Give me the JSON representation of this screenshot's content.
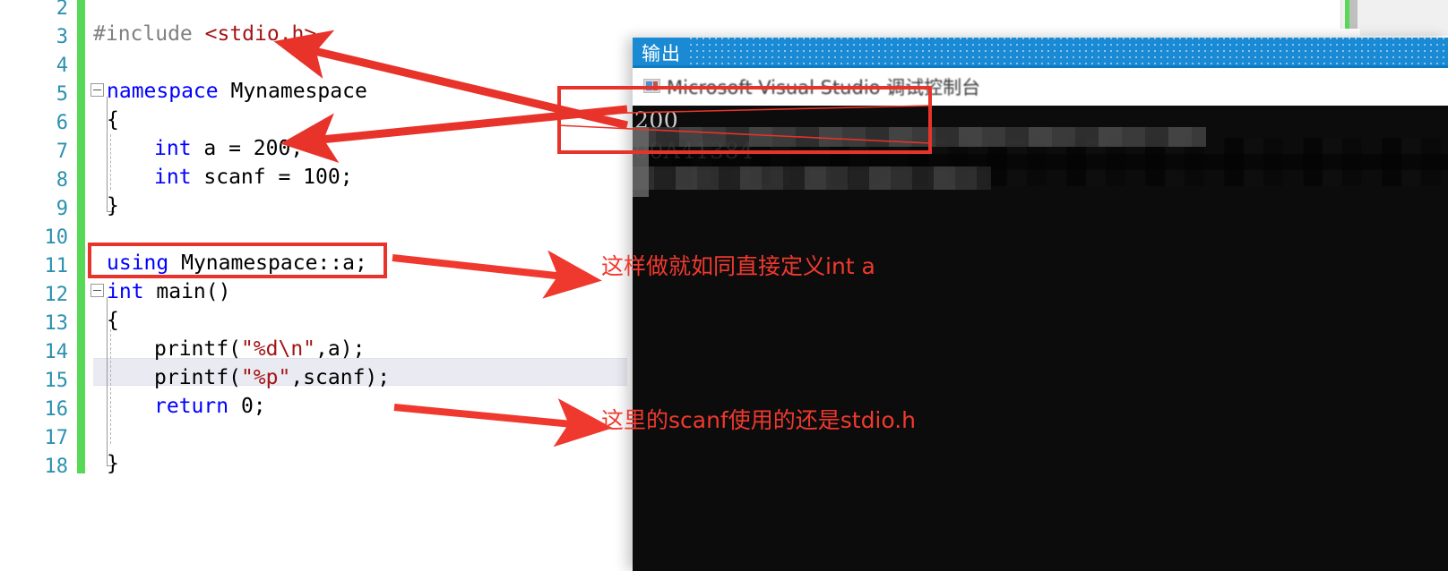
{
  "editor": {
    "name": "visual-studio-code-editor",
    "first_line_number": 2,
    "last_line_number": 18,
    "line_numbers": [
      2,
      3,
      4,
      5,
      6,
      7,
      8,
      9,
      10,
      11,
      12,
      13,
      14,
      15,
      16,
      17,
      18
    ],
    "current_line": 15,
    "colors": {
      "keyword": "#0000ff",
      "preprocessor": "#808080",
      "string": "#a31515",
      "plain": "#000000",
      "line_number": "#2b91af",
      "change_bar": "#57d957",
      "current_line_highlight": "#eaeaf2"
    },
    "lines": [
      {
        "n": 2,
        "text": ""
      },
      {
        "n": 3,
        "text": "#include <stdio.h>"
      },
      {
        "n": 4,
        "text": ""
      },
      {
        "n": 5,
        "text": "namespace Mynamespace"
      },
      {
        "n": 6,
        "text": "{"
      },
      {
        "n": 7,
        "text": "    int a = 200;"
      },
      {
        "n": 8,
        "text": "    int scanf = 100;"
      },
      {
        "n": 9,
        "text": "}"
      },
      {
        "n": 10,
        "text": ""
      },
      {
        "n": 11,
        "text": "using Mynamespace::a;"
      },
      {
        "n": 12,
        "text": "int main()"
      },
      {
        "n": 13,
        "text": "{"
      },
      {
        "n": 14,
        "text": "    printf(\"%d\\n\",a);"
      },
      {
        "n": 15,
        "text": "    printf(\"%p\",scanf);"
      },
      {
        "n": 16,
        "text": "    return 0;"
      },
      {
        "n": 17,
        "text": ""
      },
      {
        "n": 18,
        "text": "}"
      }
    ],
    "tokens": {
      "l3_include": "#include ",
      "l3_header": "<stdio.h>",
      "l5_kw": "namespace",
      "l5_name": " Mynamespace",
      "l6": "{",
      "l7_kw": "int",
      "l7_rest": " a = 200;",
      "l8_kw": "int",
      "l8_rest": " scanf = 100;",
      "l9": "}",
      "l11_kw": "using",
      "l11_rest": " Mynamespace::a;",
      "l12_kw": "int",
      "l12_rest": " main()",
      "l13": "{",
      "l14_a": "printf(",
      "l14_str": "\"%d\\n\"",
      "l14_b": ",a);",
      "l15_a": "printf(",
      "l15_str": "\"%p\"",
      "l15_b": ",scanf);",
      "l16_kw": "return",
      "l16_rest": " 0;",
      "l18": "}"
    }
  },
  "console": {
    "title": "输出",
    "header_text": "Microsoft Visual Studio 调试控制台",
    "output_lines": [
      "200",
      "00A41384"
    ],
    "background": "#0c0c0c",
    "titlebar_color": "#1a8ad4",
    "text_color": "#cccccc"
  },
  "annotations": {
    "color": "#f0392e",
    "notes": [
      {
        "id": "note-using",
        "text": "这样做就如同直接定义int a"
      },
      {
        "id": "note-scanf",
        "text": "这里的scanf使用的还是stdio.h"
      }
    ],
    "boxes": [
      {
        "id": "box-using-line",
        "target": "using Mynamespace::a;"
      },
      {
        "id": "box-console-output",
        "target": "200 / 00A41384"
      }
    ],
    "arrows": [
      {
        "id": "arrow-to-stdio-h",
        "from": "console output box",
        "to": "<stdio.h>"
      },
      {
        "id": "arrow-to-int-a",
        "from": "console output box",
        "to": "int a = 200;"
      },
      {
        "id": "arrow-to-note-using",
        "from": "using line box",
        "to": "这样做就如同直接定义int a"
      },
      {
        "id": "arrow-to-note-scanf",
        "from": "return 0; line",
        "to": "这里的scanf使用的还是stdio.h"
      }
    ]
  }
}
